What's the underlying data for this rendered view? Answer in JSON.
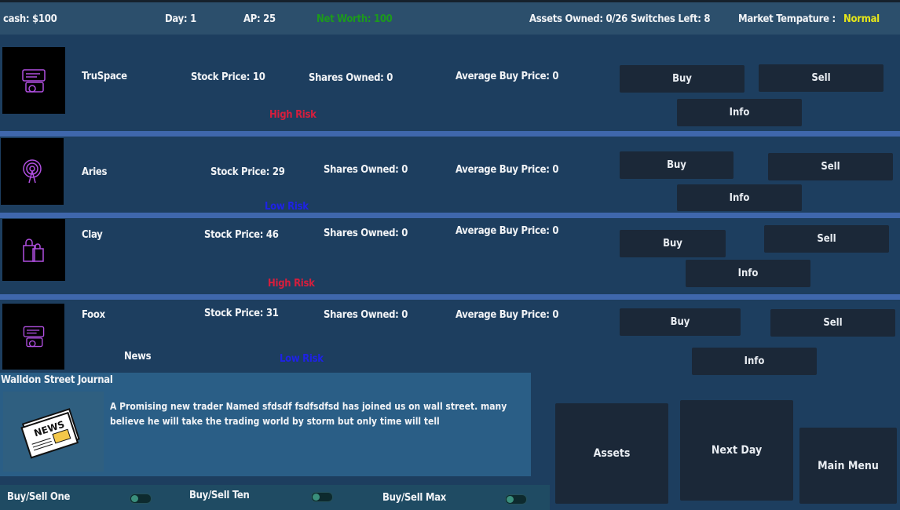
{
  "topbar": {
    "cash": "cash: $100",
    "day": "Day: 1",
    "ap": "AP: 25",
    "net_worth": "Net Worth: 100",
    "assets_owned": "Assets Owned: 0/26",
    "switches_left": "Switches Left: 8",
    "market_temp_label": "Market Tempature :",
    "market_temp_value": "Normal"
  },
  "stocks": [
    {
      "name": "TruSpace",
      "price": "Stock Price: 10",
      "shares": "Shares Owned: 0",
      "avg": "Average Buy Price: 0",
      "risk": "High Risk",
      "icon": "chat-bubbles-icon"
    },
    {
      "name": "Aries",
      "price": "Stock Price: 29",
      "shares": "Shares Owned: 0",
      "avg": "Average Buy Price: 0",
      "risk": "Low Risk",
      "icon": "signal-tower-icon"
    },
    {
      "name": "Clay",
      "price": "Stock Price: 46",
      "shares": "Shares Owned: 0",
      "avg": "Average Buy Price: 0",
      "risk": "High Risk",
      "icon": "shopping-bags-icon"
    },
    {
      "name": "Foox",
      "price": "Stock Price: 31",
      "shares": "Shares Owned: 0",
      "avg": "Average Buy Price: 0",
      "risk": "Low Risk",
      "icon": "chat-bubbles-icon"
    }
  ],
  "buttons": {
    "buy": "Buy",
    "sell": "Sell",
    "info": "Info",
    "assets": "Assets",
    "next_day": "Next Day",
    "main_menu": "Main Menu"
  },
  "news": {
    "section_label": "News",
    "headline": "Walldon Street Journal",
    "body": "A Promising new trader Named sfdsdf fsdfsdfsd has joined us on wall street. many believe he will take the trading world by storm but only time will tell",
    "image_icon": "newspaper-icon"
  },
  "toggles": [
    {
      "label": "Buy/Sell One",
      "on": false
    },
    {
      "label": "Buy/Sell Ten",
      "on": false
    },
    {
      "label": "Buy/Sell Max",
      "on": false
    }
  ],
  "colors": {
    "net_worth": "#1c9a1c",
    "market_normal": "#e6e61a",
    "high_risk": "#d61e3d",
    "low_risk": "#1e22e6",
    "icon_stroke": "#b04fe0"
  }
}
